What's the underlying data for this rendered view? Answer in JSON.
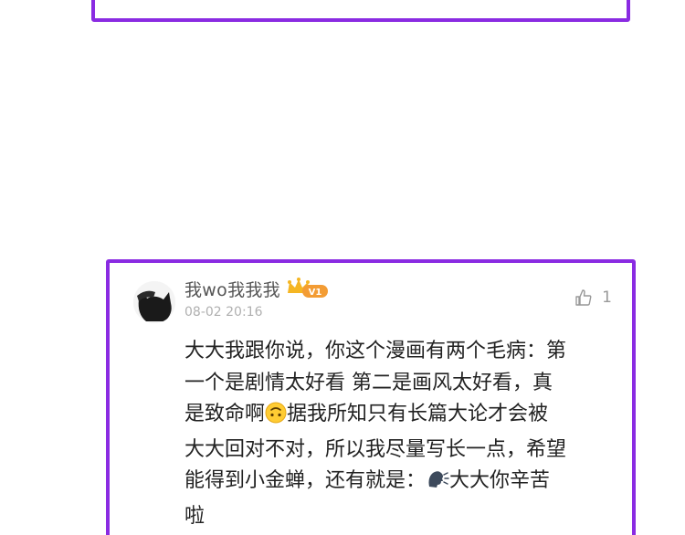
{
  "comment": {
    "username": "我wo我我我",
    "vip_label": "V1",
    "timestamp": "08-02 20:16",
    "like_count": "1",
    "lines": [
      "大大我跟你说，你这个漫画有两个毛病：第",
      "一个是剧情太好看 第二是画风太好看，真",
      "是致命啊",
      "据我所知只有长篇大论才会被",
      "大大回对不对，所以我尽量写长一点，希望",
      "能得到小金蝉，还有就是：",
      "大大你辛苦",
      "啦"
    ],
    "emojis": [
      "upside-down-face-emoji",
      "speaking-head-emoji"
    ]
  },
  "colors": {
    "card_border": "#8a2be2",
    "vip_badge": "#f5a623",
    "text": "#222222",
    "muted": "#b0b0b0"
  }
}
